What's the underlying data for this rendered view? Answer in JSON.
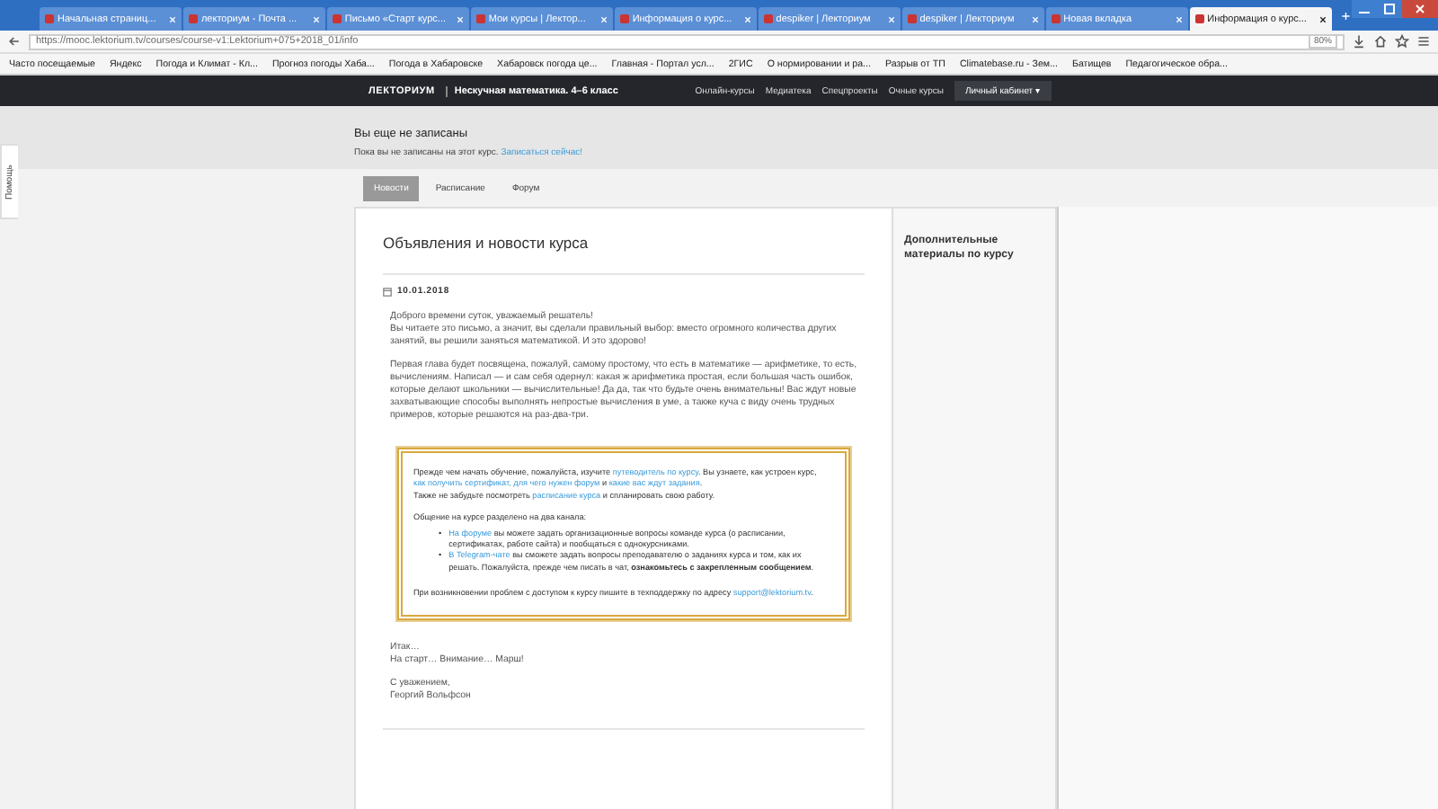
{
  "browser": {
    "tabs": [
      {
        "title": "Начальная страниц...",
        "selected": false
      },
      {
        "title": "лекториум - Почта ...",
        "selected": false
      },
      {
        "title": "Письмо «Старт курс...",
        "selected": false
      },
      {
        "title": "Мои курсы | Лектор...",
        "selected": false
      },
      {
        "title": "Информация о курс...",
        "selected": false
      },
      {
        "title": "despiker | Лекториум",
        "selected": false
      },
      {
        "title": "despiker | Лекториум",
        "selected": false
      },
      {
        "title": "Новая вкладка",
        "selected": false
      },
      {
        "title": "Информация о курс...",
        "selected": true
      }
    ],
    "url": "https://mooc.lektorium.tv/courses/course-v1:Lektorium+075+2018_01/info",
    "zoom": "80%",
    "bookmarks": [
      "Часто посещаемые",
      "Яндекс",
      "Погода и Климат - Кл...",
      "Прогноз погоды Хаба...",
      "Погода в Хабаровске",
      "Хабаровск погода це...",
      "Главная - Портал усл...",
      "2ГИС",
      "О нормировании и ра...",
      "Разрыв от ТП",
      "Climatebase.ru - Зем...",
      "Батищев",
      "Педагогическое обра..."
    ]
  },
  "site_header": {
    "logo": "ЛЕКТОРИУМ",
    "course": "Нескучная математика. 4–6 класс",
    "nav": [
      "Онлайн-курсы",
      "Медиатека",
      "Спецпроекты",
      "Очные курсы"
    ],
    "account_button": "Личный кабинет ▾"
  },
  "enrollment": {
    "title": "Вы еще не записаны",
    "text": "Пока вы не записаны на этот курс.",
    "link": "Записаться сейчас!"
  },
  "help_tab": "Помощь",
  "course_tabs": [
    {
      "label": "Новости",
      "selected": true
    },
    {
      "label": "Расписание",
      "selected": false
    },
    {
      "label": "Форум",
      "selected": false
    }
  ],
  "announcements": {
    "title": "Объявления и новости курса",
    "date": "10.01.2018",
    "paragraphs": [
      [
        "Доброго времени суток, уважаемый решатель!",
        "Вы читаете это письмо, а значит, вы сделали правильный выбор: вместо огромного количества других занятий, вы решили заняться математикой. И это здорово!"
      ],
      [
        "Первая глава будет посвящена, пожалуй, самому простому, что есть в математике — арифметике, то есть, вычислениям. Написал — и сам себя одернул: какая ж арифметика простая, если большая часть ошибок, которые делают школьники — вычислительные! Да да, так что будьте очень внимательны! Вас ждут новые захватывающие способы выполнять непростые вычисления в уме, а также куча с виду очень трудных примеров, которые решаются на раз-два-три."
      ]
    ],
    "notice": [
      {
        "kind": "para",
        "segments": [
          {
            "kind": "text",
            "text": "Прежде чем начать обучение, пожалуйста, изучите "
          },
          {
            "kind": "link",
            "text": "путеводитель по курсу"
          },
          {
            "kind": "text",
            "text": ". Вы узнаете, как устроен курс, "
          },
          {
            "kind": "link",
            "text": "как получить сертификат, для чего нужен форум"
          },
          {
            "kind": "text",
            "text": " и "
          },
          {
            "kind": "link",
            "text": "какие вас ждут задания"
          },
          {
            "kind": "text",
            "text": "."
          }
        ]
      },
      {
        "kind": "para",
        "segments": [
          {
            "kind": "text",
            "text": "Также не забудьте посмотреть "
          },
          {
            "kind": "link",
            "text": "расписание курса"
          },
          {
            "kind": "text",
            "text": " и спланировать свою работу."
          }
        ]
      },
      {
        "kind": "gap"
      },
      {
        "kind": "para",
        "segments": [
          {
            "kind": "text",
            "text": "Общение на курсе разделено на два канала:"
          }
        ]
      },
      {
        "kind": "list",
        "marker": "•",
        "items": [
          [
            {
              "kind": "link",
              "text": "На форуме"
            },
            {
              "kind": "text",
              "text": " вы можете задать организационные вопросы команде курса (о расписании, сертификатах, работе сайта) и пообщаться с однокурсниками."
            }
          ],
          [
            {
              "kind": "link",
              "text": "В Telegram-чате"
            },
            {
              "kind": "text",
              "text": " вы сможете задать вопросы преподавателю о заданиях курса и том, как их решать. Пожалуйста, прежде чем писать в чат, "
            },
            {
              "kind": "bold",
              "text": "ознакомьтесь с закрепленным сообщением"
            },
            {
              "kind": "text",
              "text": "."
            }
          ]
        ]
      },
      {
        "kind": "gap"
      },
      {
        "kind": "para",
        "segments": [
          {
            "kind": "text",
            "text": "При возникновении проблем с доступом к курсу пишите в техподдержку по адресу "
          },
          {
            "kind": "link",
            "text": "support@lektorium.tv"
          },
          {
            "kind": "text",
            "text": "."
          }
        ]
      }
    ],
    "closing": [
      [
        "Итак…",
        "На старт… Внимание… Марш!"
      ],
      [
        "С уважением,",
        "Георгий Вольфсон"
      ]
    ]
  },
  "sidebar": {
    "title": "Дополнительные материалы по курсу"
  }
}
